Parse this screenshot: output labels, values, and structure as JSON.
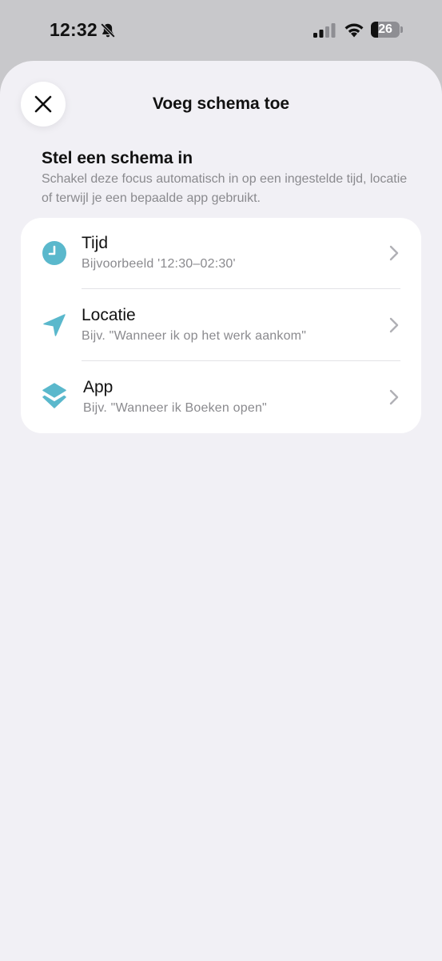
{
  "status_bar": {
    "time": "12:32",
    "battery_level": "26",
    "battery_fraction": 0.26
  },
  "sheet": {
    "title": "Voeg schema toe"
  },
  "section": {
    "title": "Stel een schema in",
    "description": "Schakel deze focus automatisch in op een ingestelde tijd, locatie of terwijl je een bepaalde app gebruikt."
  },
  "options": [
    {
      "label": "Tijd",
      "sub": "Bijvoorbeeld '12:30–02:30'",
      "icon": "clock-icon"
    },
    {
      "label": "Locatie",
      "sub": "Bijv. \"Wanneer ik op het werk aankom\"",
      "icon": "location-arrow-icon"
    },
    {
      "label": "App",
      "sub": "Bijv. \"Wanneer ik Boeken open\"",
      "icon": "app-stack-icon"
    }
  ],
  "colors": {
    "accent": "#5ab8cc",
    "sheet_bg": "#f1f0f5",
    "secondary_text": "#8a8a8e"
  }
}
